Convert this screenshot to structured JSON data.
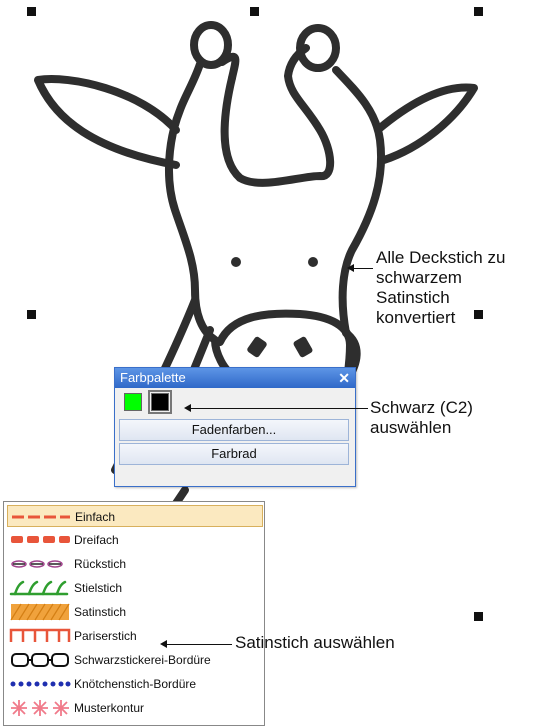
{
  "callouts": {
    "converted": [
      "Alle Deckstich zu",
      "schwarzem",
      "Satinstich",
      "konvertiert"
    ],
    "select_black": [
      "Schwarz (C2)",
      "auswählen"
    ],
    "select_satin": "Satinstich auswählen"
  },
  "palette": {
    "title": "Farbpalette",
    "close_icon": "close-icon",
    "swatches": [
      {
        "name": "green",
        "color": "#00ff00"
      },
      {
        "name": "black",
        "color": "#000000",
        "selected": true
      }
    ],
    "buttons": [
      "Fadenfarben...",
      "Farbrad"
    ]
  },
  "stitch_list": {
    "items": [
      {
        "label": "Einfach",
        "icon": "single-stitch-icon",
        "selected": true
      },
      {
        "label": "Dreifach",
        "icon": "triple-stitch-icon"
      },
      {
        "label": "Rückstich",
        "icon": "backstitch-icon"
      },
      {
        "label": "Stielstich",
        "icon": "stem-stitch-icon"
      },
      {
        "label": "Satinstich",
        "icon": "satin-stitch-icon"
      },
      {
        "label": "Pariserstich",
        "icon": "paris-stitch-icon"
      },
      {
        "label": "Schwarzstickerei-Bordüre",
        "icon": "blackwork-border-icon"
      },
      {
        "label": "Knötchenstich-Bordüre",
        "icon": "knot-stitch-border-icon"
      },
      {
        "label": "Musterkontur",
        "icon": "pattern-outline-icon"
      }
    ]
  },
  "colors": {
    "outline": "#2e2e2e",
    "accent_red": "#e8553a",
    "accent_orange": "#f0a23c",
    "accent_green": "#2f9e2f",
    "accent_blue": "#1f2fb0",
    "accent_pink": "#f07a8a",
    "selection": "#fbe9c0"
  }
}
